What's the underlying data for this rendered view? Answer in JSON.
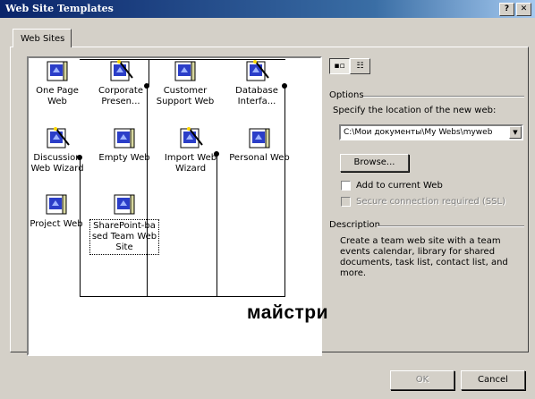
{
  "window": {
    "title": "Web Site Templates",
    "help_btn": "?",
    "close_btn": "✕"
  },
  "tabs": [
    {
      "label": "Web Sites"
    }
  ],
  "templates": [
    {
      "label": "One Page\nWeb",
      "icon": "page-icon",
      "wizard": false
    },
    {
      "label": "Corporate\nPresen...",
      "icon": "wizard-wand-icon",
      "wizard": true
    },
    {
      "label": "Customer\nSupport Web",
      "icon": "page-icon",
      "wizard": false
    },
    {
      "label": "Database\nInterfa...",
      "icon": "wizard-wand-icon",
      "wizard": true
    },
    {
      "label": "Discussion\nWeb Wizard",
      "icon": "wizard-wand-icon",
      "wizard": true
    },
    {
      "label": "Empty Web",
      "icon": "page-icon",
      "wizard": false
    },
    {
      "label": "Import Web\nWizard",
      "icon": "wizard-wand-icon",
      "wizard": true
    },
    {
      "label": "Personal Web",
      "icon": "page-icon",
      "wizard": false
    },
    {
      "label": "Project Web",
      "icon": "page-icon",
      "wizard": false
    },
    {
      "label": "SharePoint-ba\nsed Team Web\nSite",
      "icon": "page-icon",
      "wizard": false,
      "selected": true
    }
  ],
  "annotation": "майстри",
  "view_buttons": {
    "large_icons": "▪▫",
    "details": "☷"
  },
  "options": {
    "group_label": "Options",
    "location_label": "Specify the location of the new web:",
    "location_value": "C:\\Мои документы\\My Webs\\myweb",
    "browse_label": "Browse...",
    "add_to_current_label": "Add to current Web",
    "secure_label": "Secure connection required (SSL)"
  },
  "description": {
    "group_label": "Description",
    "text": "Create a team web site with a team events calendar, library for shared documents, task list, contact list, and more."
  },
  "buttons": {
    "ok": "OK",
    "cancel": "Cancel"
  },
  "colors": {
    "titlebar_start": "#0a246a",
    "titlebar_end": "#a6caf0",
    "face": "#d4d0c8"
  }
}
